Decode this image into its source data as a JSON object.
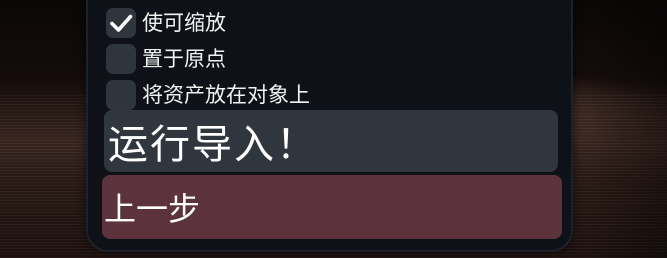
{
  "options": [
    {
      "label": "使可缩放",
      "checked": true
    },
    {
      "label": "置于原点",
      "checked": false
    },
    {
      "label": "将资产放在对象上",
      "checked": false
    }
  ],
  "buttons": {
    "run_import": "运行导入！",
    "previous_step": "上一步"
  },
  "colors": {
    "panel": "#0e1218",
    "checkbox": "#2f353d",
    "run_button": "#30363e",
    "previous_button": "#5c333c",
    "text": "#f2f2f2"
  }
}
